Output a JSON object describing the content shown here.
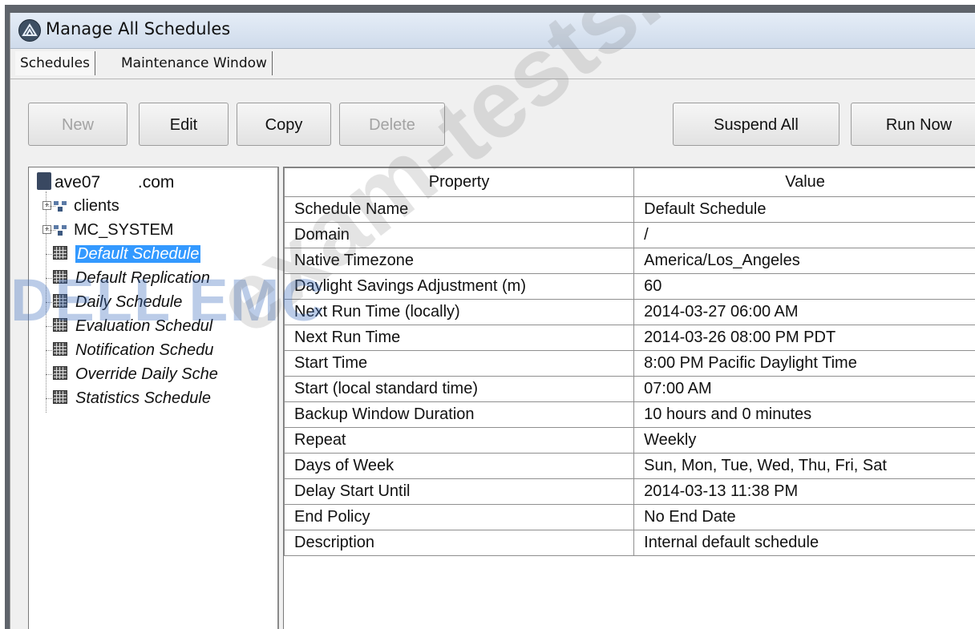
{
  "window": {
    "title": "Manage All Schedules",
    "icon": "app-logo-icon"
  },
  "tabs": [
    {
      "label": "Schedules"
    },
    {
      "label": "Maintenance Window"
    }
  ],
  "toolbar": {
    "new_label": "New",
    "edit_label": "Edit",
    "copy_label": "Copy",
    "delete_label": "Delete",
    "suspend_all_label": "Suspend All",
    "run_now_label": "Run Now"
  },
  "tree": {
    "root_label": "ave07        .com",
    "root_icon": "server-icon",
    "items": [
      {
        "label": "clients",
        "icon": "domain-icon",
        "expandable": true
      },
      {
        "label": "MC_SYSTEM",
        "icon": "domain-icon",
        "expandable": true
      },
      {
        "label": "Default Schedule",
        "icon": "calendar-icon",
        "selected": true
      },
      {
        "label": "Default Replication",
        "icon": "calendar-icon"
      },
      {
        "label": "Daily Schedule",
        "icon": "calendar-icon"
      },
      {
        "label": "Evaluation Schedul",
        "icon": "calendar-icon"
      },
      {
        "label": "Notification Schedu",
        "icon": "calendar-icon"
      },
      {
        "label": "Override Daily Sche",
        "icon": "calendar-icon"
      },
      {
        "label": "Statistics Schedule",
        "icon": "calendar-icon"
      }
    ]
  },
  "properties": {
    "headers": [
      "Property",
      "Value"
    ],
    "rows": [
      [
        "Schedule Name",
        "Default Schedule"
      ],
      [
        "Domain",
        "/"
      ],
      [
        "Native Timezone",
        "America/Los_Angeles"
      ],
      [
        "Daylight Savings Adjustment (m)",
        "60"
      ],
      [
        "Next Run Time (locally)",
        "2014-03-27 06:00 AM"
      ],
      [
        "Next Run Time",
        "2014-03-26 08:00 PM PDT"
      ],
      [
        "Start Time",
        "8:00 PM Pacific Daylight Time"
      ],
      [
        "Start (local standard time)",
        "07:00 AM"
      ],
      [
        "Backup Window Duration",
        "10 hours and 0 minutes"
      ],
      [
        "Repeat",
        "Weekly"
      ],
      [
        "Days of Week",
        "Sun, Mon, Tue, Wed, Thu, Fri, Sat"
      ],
      [
        "Delay Start Until",
        "2014-03-13 11:38 PM"
      ],
      [
        "End Policy",
        "No End Date"
      ],
      [
        "Description",
        "Internal default schedule"
      ]
    ]
  },
  "watermark": {
    "text": "exam-tests.com",
    "logo_text": "DELL EMC"
  },
  "colors": {
    "selection": "#3399ff",
    "titlebar": "#d8e3f0",
    "disabled_text": "#a3a3a3"
  }
}
